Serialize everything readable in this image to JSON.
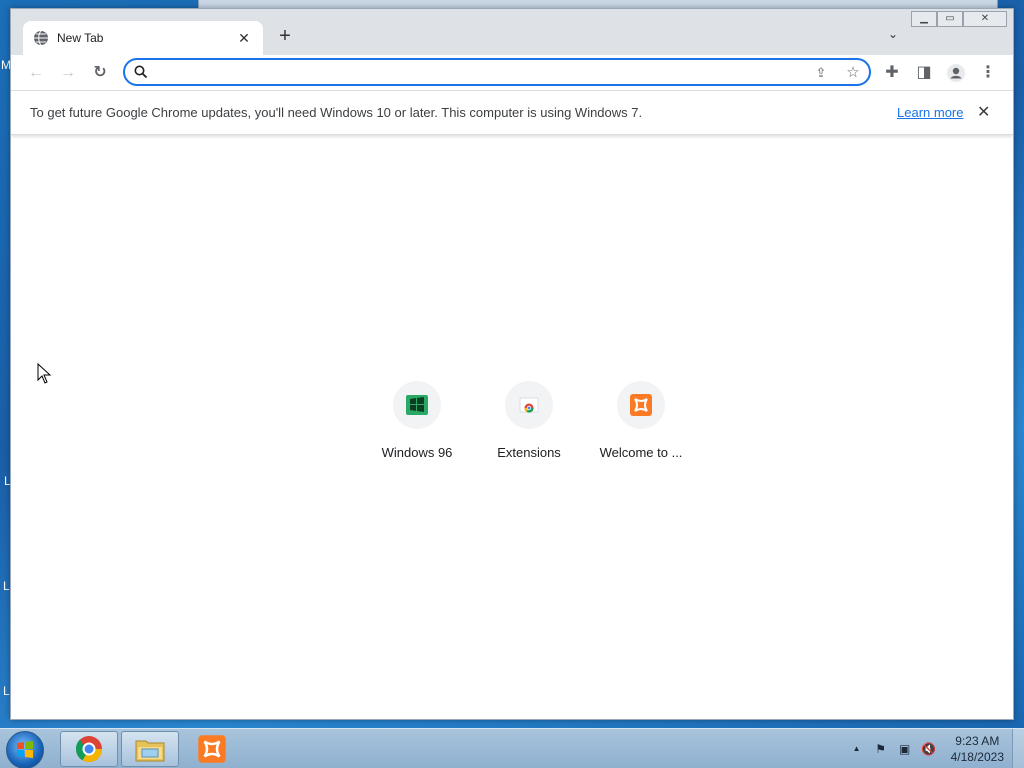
{
  "desktop": {
    "edge_letters": [
      "M",
      "L",
      "L",
      "L"
    ]
  },
  "window": {
    "tab": {
      "title": "New Tab",
      "close_glyph": "✕"
    },
    "new_tab_glyph": "+",
    "tab_search_glyph": "⌄",
    "controls": {
      "minimize": "▁",
      "maximize": "▭",
      "close": "✕"
    }
  },
  "toolbar": {
    "back_glyph": "←",
    "forward_glyph": "→",
    "reload_glyph": "↻",
    "omnibox": {
      "value": "",
      "placeholder": ""
    },
    "share_glyph": "⇪",
    "star_glyph": "☆",
    "extensions_glyph": "✚",
    "sidepanel_glyph": "◨",
    "menu_glyph": "⋮"
  },
  "infobar": {
    "message": "To get future Google Chrome updates, you'll need Windows 10 or later. This computer is using Windows 7.",
    "link": "Learn more",
    "close_glyph": "✕"
  },
  "shortcuts": [
    {
      "label": "Windows 96",
      "icon": "windows96-icon"
    },
    {
      "label": "Extensions",
      "icon": "chrome-extensions-icon"
    },
    {
      "label": "Welcome to ...",
      "icon": "xampp-icon"
    }
  ],
  "taskbar": {
    "pinned": [
      "chrome-icon",
      "file-explorer-icon",
      "xampp-icon"
    ],
    "tray": {
      "show_hidden": "▲",
      "flag": "⚑",
      "network": "▣",
      "volume": "🔇"
    },
    "clock": {
      "time": "9:23 AM",
      "date": "4/18/2023"
    }
  },
  "colors": {
    "accent": "#1a73e8",
    "tabstrip": "#dee1e6",
    "xampp_orange": "#fb7a24",
    "w96_green": "#2aa866"
  }
}
